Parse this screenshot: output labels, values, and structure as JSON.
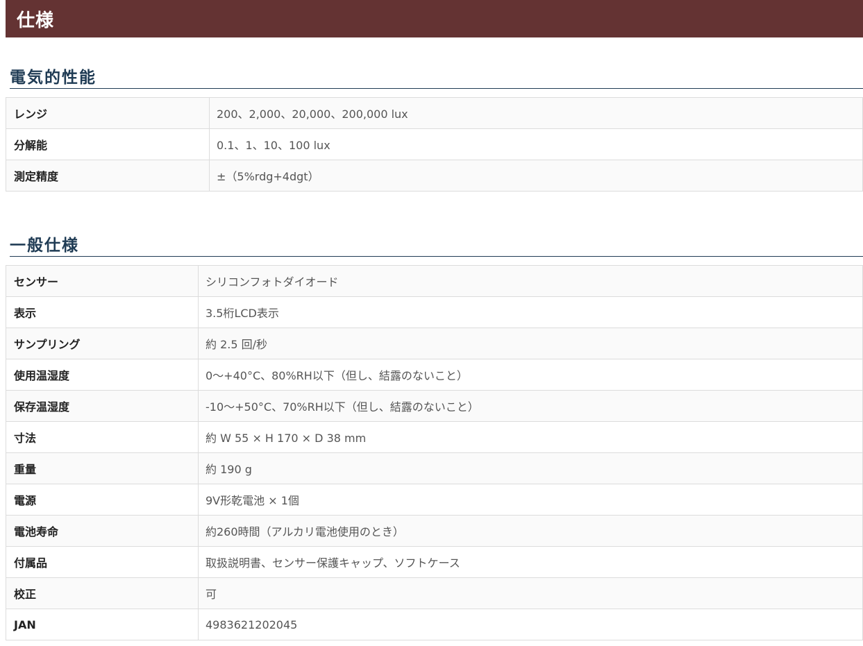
{
  "header": {
    "title": "仕様"
  },
  "electrical": {
    "title": "電気的性能",
    "rows": [
      {
        "label": "レンジ",
        "value": "200、2,000、20,000、200,000 lux"
      },
      {
        "label": "分解能",
        "value": "0.1、1、10、100 lux"
      },
      {
        "label": "測定精度",
        "value": "±（5%rdg+4dgt）"
      }
    ]
  },
  "general": {
    "title": "一般仕様",
    "rows": [
      {
        "label": "センサー",
        "value": "シリコンフォトダイオード"
      },
      {
        "label": "表示",
        "value": "3.5桁LCD表示"
      },
      {
        "label": "サンプリング",
        "value": "約 2.5 回/秒"
      },
      {
        "label": "使用温湿度",
        "value": "0～+40°C、80%RH以下（但し、結露のないこと）"
      },
      {
        "label": "保存温湿度",
        "value": "-10～+50°C、70%RH以下（但し、結露のないこと）"
      },
      {
        "label": "寸法",
        "value": "約 W 55 × H 170 × D 38 mm"
      },
      {
        "label": "重量",
        "value": "約 190 g"
      },
      {
        "label": "電源",
        "value": "9V形乾電池 × 1個"
      },
      {
        "label": "電池寿命",
        "value": "約260時間（アルカリ電池使用のとき）"
      },
      {
        "label": "付属品",
        "value": "取扱説明書、センサー保護キャップ、ソフトケース"
      },
      {
        "label": "校正",
        "value": "可"
      },
      {
        "label": "JAN",
        "value": "4983621202045"
      }
    ]
  },
  "colors": {
    "header_bg": "#643333",
    "section_title": "#1f3b54",
    "border": "#dcdcdc"
  }
}
